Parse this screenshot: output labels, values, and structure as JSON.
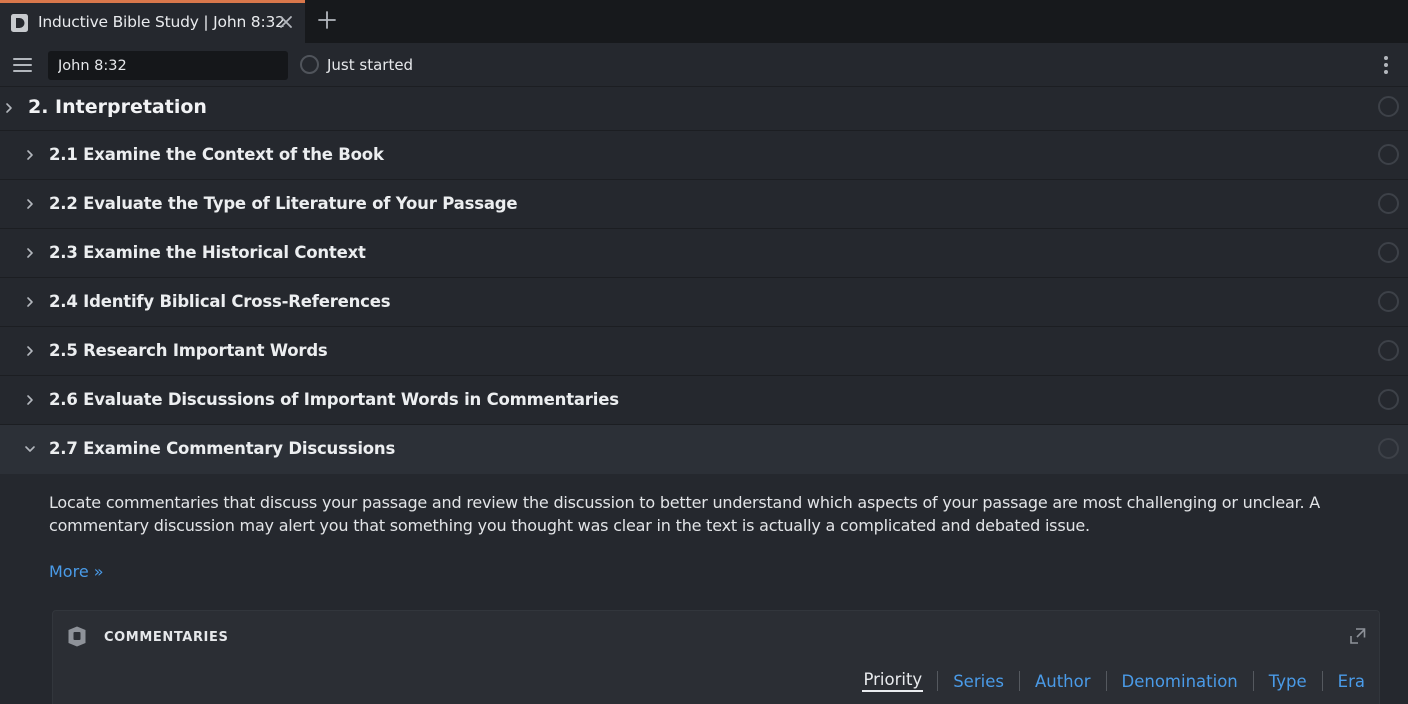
{
  "tab": {
    "title": "Inductive Bible Study | John 8:32",
    "accent_color": "#d9774b"
  },
  "toolbar": {
    "reference_value": "John 8:32",
    "status": "Just started"
  },
  "section": {
    "title": "2. Interpretation"
  },
  "steps": [
    {
      "label": "2.1 Examine the Context of the Book"
    },
    {
      "label": "2.2 Evaluate the Type of Literature of Your Passage"
    },
    {
      "label": "2.3 Examine the Historical Context"
    },
    {
      "label": "2.4 Identify Biblical Cross-References"
    },
    {
      "label": "2.5 Research Important Words"
    },
    {
      "label": "2.6 Evaluate Discussions of Important Words in Commentaries"
    },
    {
      "label": "2.7 Examine Commentary Discussions"
    }
  ],
  "expanded": {
    "description": "Locate commentaries that discuss your passage and review the discussion to better understand which aspects of your passage are most challenging or unclear. A commentary discussion may alert you that something you thought was clear in the text is actually a complicated and debated issue.",
    "more_label": "More »"
  },
  "panel": {
    "title": "COMMENTARIES",
    "sort_options": [
      "Priority",
      "Series",
      "Author",
      "Denomination",
      "Type",
      "Era"
    ],
    "active_sort": "Priority"
  },
  "colors": {
    "link": "#4a9be8",
    "background": "#25282e",
    "tabbar": "#17191c"
  }
}
